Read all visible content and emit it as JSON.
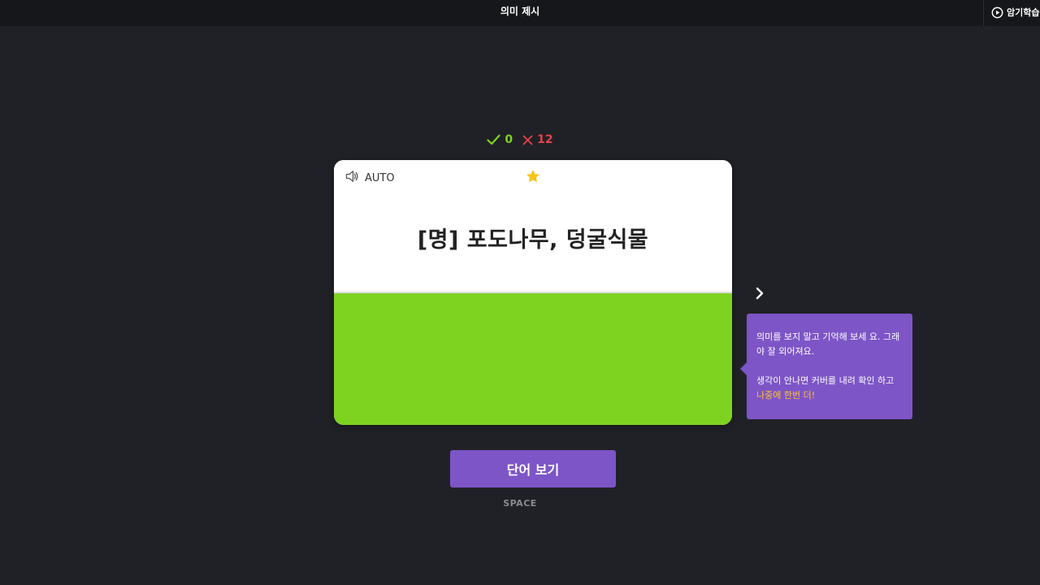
{
  "header": {
    "title": "의미 제시",
    "memorize_label": "암기학습"
  },
  "score": {
    "correct": "0",
    "wrong": "12"
  },
  "card": {
    "auto_label": "AUTO",
    "meaning": "[명] 포도나무, 덩굴식물",
    "starred": true
  },
  "tip": {
    "line1": "의미를 보지 말고 기억해 보세 요. 그래야 잘 외어져요.",
    "line2_prefix": "생각이 안나면 커버를 내려 확인 하고 ",
    "line2_highlight": "나중에 한번 더!"
  },
  "actions": {
    "show_word_label": "단어 보기",
    "shortcut_label": "SPACE"
  },
  "colors": {
    "background": "#202126",
    "accent": "#7d55c7",
    "cover": "#7ed321",
    "correct": "#7ed321",
    "wrong": "#e8414a",
    "highlight": "#ffc132",
    "star": "#f5c518"
  }
}
